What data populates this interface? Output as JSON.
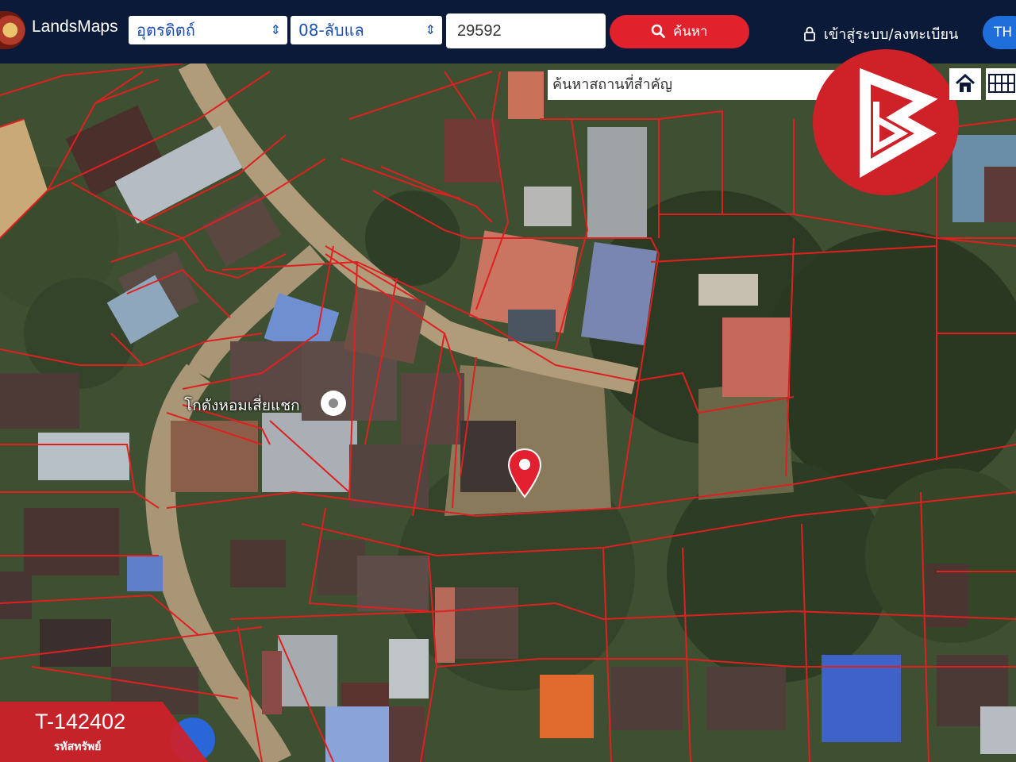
{
  "header": {
    "brand": "LandsMaps",
    "province": "อุตรดิตถ์",
    "district": "08-ลับแล",
    "parcel_number": "29592",
    "search_label": "ค้นหา",
    "login_label": "เข้าสู่ระบบ/ลงทะเบียน",
    "language": "TH"
  },
  "map": {
    "place_search_placeholder": "ค้นหาสถานที่สำคัญ",
    "poi_label": "โกดังหอมเสี่ยแชก"
  },
  "property": {
    "code": "T-142402",
    "code_label": "รหัสทรัพย์"
  },
  "colors": {
    "topbar": "#0c1a3a",
    "accent_red": "#e1222d",
    "brand_red": "#cf2128",
    "lang_blue": "#1e6fd9",
    "parcel_line": "#e02020"
  },
  "icons": {
    "search": "magnifier",
    "login": "lock-icon",
    "home": "home-icon",
    "grid": "grid-icon",
    "location": "map-pin-icon"
  }
}
